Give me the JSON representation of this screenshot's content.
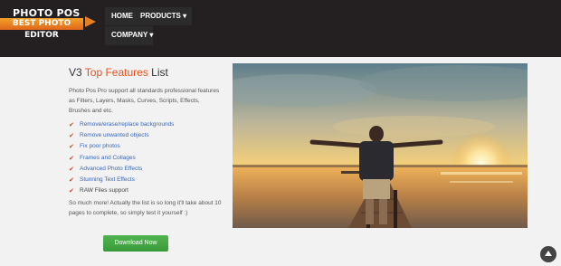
{
  "header": {
    "logo_line1": "PHOTO POS PRO",
    "logo_line2": "BEST PHOTO EDITOR",
    "nav": {
      "home": "HOME",
      "products": "PRODUCTS",
      "company": "COMPANY"
    },
    "caret": "▾"
  },
  "main": {
    "title_prefix": "V3 ",
    "title_highlight": "Top Features",
    "title_suffix": " List",
    "intro": "Photo Pos Pro support all standards professional features as Filters, Layers, Masks, Curves, Scripts, Effects, Brushes and etc.",
    "features": [
      "Remove/erase/replace backgrounds",
      "Remove unwanted objects",
      "Fix poor photos",
      "Frames and Collages",
      "Advanced Photo Effects",
      "Stunning Text Effects",
      "RAW Files support"
    ],
    "check_glyph": "✔",
    "outro": "So much more! Actually the list is so long it'll take about 10 pages to complete, so simply test it yourself :)",
    "download_label": "Download Now"
  },
  "colors": {
    "accent": "#e8511d",
    "link": "#3a68b5",
    "button": "#46a946",
    "header_bg": "#242021"
  },
  "icons": {
    "scroll_top": "chevron-up-icon"
  }
}
